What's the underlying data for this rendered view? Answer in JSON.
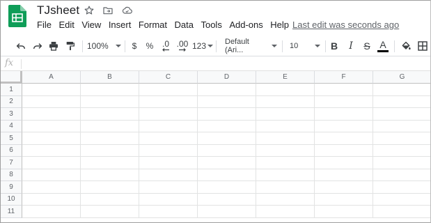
{
  "document": {
    "title": "TJsheet",
    "last_edit": "Last edit was seconds ago"
  },
  "menu": [
    "File",
    "Edit",
    "View",
    "Insert",
    "Format",
    "Data",
    "Tools",
    "Add-ons",
    "Help"
  ],
  "toolbar": {
    "zoom": "100%",
    "currency": "$",
    "percent": "%",
    "decrease_decimal": ".0",
    "increase_decimal": ".00",
    "more_formats": "123",
    "font_family": "Default (Ari...",
    "font_size": "10",
    "bold": "B",
    "italic": "I",
    "strikethrough": "S",
    "text_color_letter": "A"
  },
  "formula_bar": {
    "label": "fx",
    "value": ""
  },
  "grid": {
    "columns": [
      "A",
      "B",
      "C",
      "D",
      "E",
      "F",
      "G"
    ],
    "rows": [
      "1",
      "2",
      "3",
      "4",
      "5",
      "6",
      "7",
      "8",
      "9",
      "10",
      "11"
    ]
  },
  "colors": {
    "brand_green": "#0f9d58",
    "text_color_bar": "#000000"
  }
}
